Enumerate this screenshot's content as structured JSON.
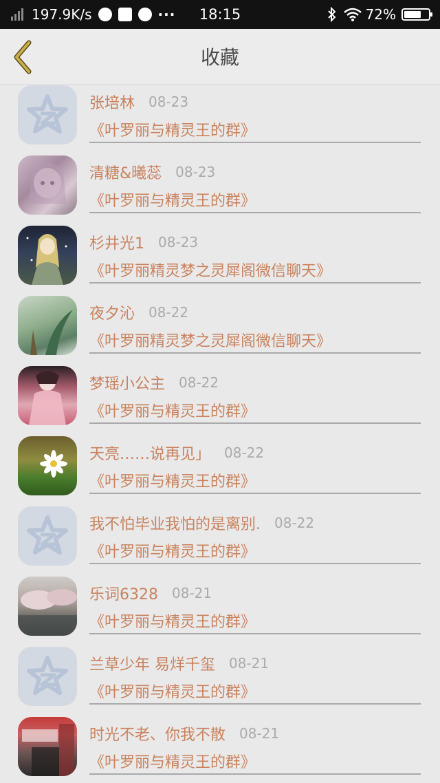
{
  "status_bar": {
    "speed": "197.9K/s",
    "time": "18:15",
    "dots": "···",
    "battery_text": "72%",
    "battery_level": 0.72
  },
  "header": {
    "title": "收藏"
  },
  "items": [
    {
      "name": "张培林",
      "date": "08-23",
      "group": "《叶罗丽与精灵王的群》"
    },
    {
      "name": "清糖&曦蕊",
      "date": "08-23",
      "group": "《叶罗丽与精灵王的群》"
    },
    {
      "name": "杉井光1",
      "date": "08-23",
      "group": "《叶罗丽精灵梦之灵犀阁微信聊天》"
    },
    {
      "name": "夜夕沁",
      "date": "08-22",
      "group": "《叶罗丽精灵梦之灵犀阁微信聊天》"
    },
    {
      "name": "梦瑶小公主",
      "date": "08-22",
      "group": "《叶罗丽与精灵王的群》"
    },
    {
      "name": "天亮……说再见」",
      "date": "08-22",
      "group": "《叶罗丽与精灵王的群》"
    },
    {
      "name": "我不怕毕业我怕的是离别.",
      "date": "08-22",
      "group": "《叶罗丽与精灵王的群》"
    },
    {
      "name": "乐词6328",
      "date": "08-21",
      "group": "《叶罗丽与精灵王的群》"
    },
    {
      "name": "兰草少年 易烊千玺",
      "date": "08-21",
      "group": "《叶罗丽与精灵王的群》"
    },
    {
      "name": "时光不老、你我不散",
      "date": "08-21",
      "group": "《叶罗丽与精灵王的群》"
    }
  ],
  "colors": {
    "accent": "#c8825e",
    "back_arrow": "#b8a03c",
    "date": "#aaaaaa"
  }
}
